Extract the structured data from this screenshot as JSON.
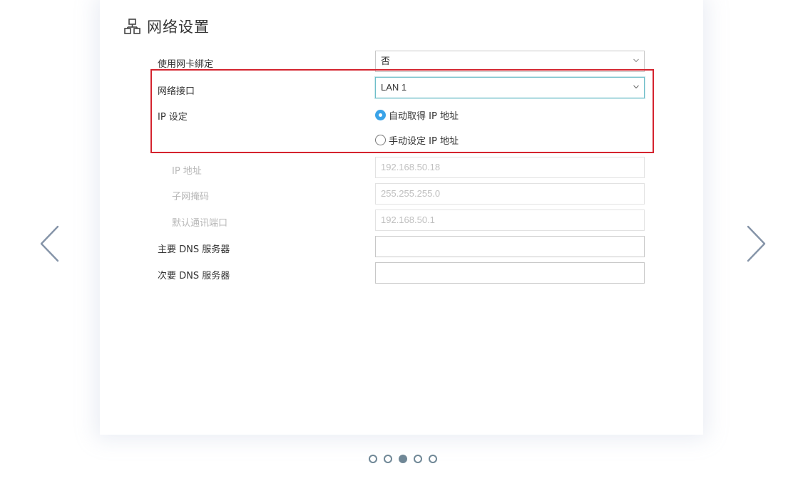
{
  "page_title": "网络设置",
  "rows": {
    "nic_binding": {
      "label": "使用网卡綁定",
      "value": "否"
    },
    "network_interface": {
      "label": "网络接口",
      "value": "LAN 1"
    },
    "ip_setting": {
      "label": "IP 设定",
      "options": [
        {
          "label": "自动取得 IP 地址",
          "checked": true
        },
        {
          "label": "手动设定 IP 地址",
          "checked": false
        }
      ]
    },
    "ip_address": {
      "label": "IP 地址",
      "value": "192.168.50.18"
    },
    "subnet_mask": {
      "label": "子网掩码",
      "value": "255.255.255.0"
    },
    "default_gateway": {
      "label": "默认通讯端口",
      "value": "192.168.50.1"
    },
    "primary_dns": {
      "label": "主要 DNS 服务器",
      "value": ""
    },
    "secondary_dns": {
      "label": "次要 DNS 服务器",
      "value": ""
    }
  },
  "icons": {
    "header": "network-icon",
    "caret": "chevron-down-icon",
    "prev": "chevron-left-icon",
    "next": "chevron-right-icon"
  },
  "pager": {
    "count": 5,
    "active": 3
  },
  "colors": {
    "highlight": "#d4232e",
    "radio_checked": "#3aa3e8",
    "focus_border": "#6cbdc8",
    "pager": "#6f8796",
    "arrow": "#8594a8"
  }
}
